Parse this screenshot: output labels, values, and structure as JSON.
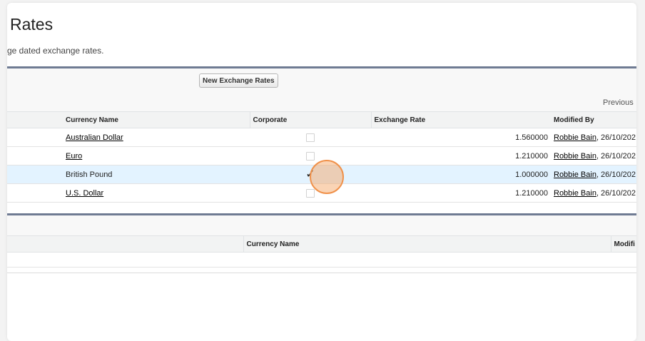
{
  "page": {
    "title": "Rates",
    "description": "ge dated exchange rates."
  },
  "panel1": {
    "new_button_label": "New Exchange Rates",
    "pagination_label": "Previous",
    "columns": {
      "currency_name": "Currency Name",
      "corporate": "Corporate",
      "exchange_rate": "Exchange Rate",
      "modified_by": "Modified By"
    },
    "rows": [
      {
        "currency_name": "Australian Dollar",
        "corporate": false,
        "exchange_rate": "1.560000",
        "modified_by_user": "Robbie Bain",
        "modified_by_date": ", 26/10/202"
      },
      {
        "currency_name": "Euro",
        "corporate": false,
        "exchange_rate": "1.210000",
        "modified_by_user": "Robbie Bain",
        "modified_by_date": ", 26/10/202"
      },
      {
        "currency_name": "British Pound",
        "corporate": true,
        "exchange_rate": "1.000000",
        "modified_by_user": "Robbie Bain",
        "modified_by_date": ", 26/10/202"
      },
      {
        "currency_name": "U.S. Dollar",
        "corporate": false,
        "exchange_rate": "1.210000",
        "modified_by_user": "Robbie Bain",
        "modified_by_date": ", 26/10/202"
      }
    ],
    "corporate_check_glyph": "✓"
  },
  "panel2": {
    "columns": {
      "currency_name": "Currency Name",
      "modified": "Modifi"
    }
  },
  "colors": {
    "panel_border": "#6f7b93",
    "row_highlight": "#e3f3ff",
    "click_indicator": "#f0914a"
  }
}
